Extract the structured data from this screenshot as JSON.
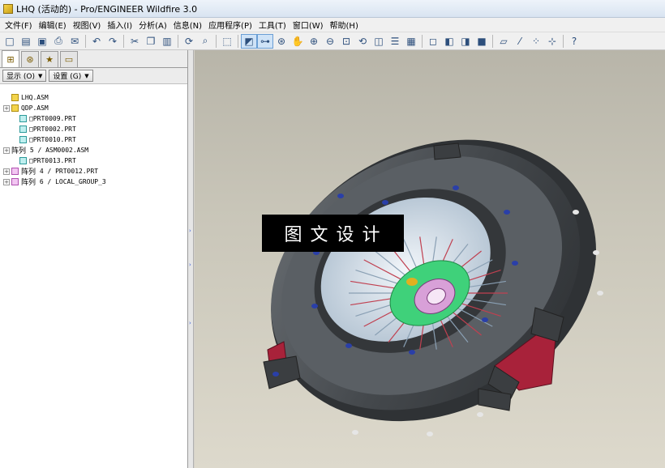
{
  "window": {
    "title": "LHQ (活动的) - Pro/ENGINEER Wildfire 3.0"
  },
  "menu": [
    "文件(F)",
    "编辑(E)",
    "视图(V)",
    "插入(I)",
    "分析(A)",
    "信息(N)",
    "应用程序(P)",
    "工具(T)",
    "窗口(W)",
    "帮助(H)"
  ],
  "toolbar": {
    "icons": [
      "new-icon",
      "open-icon",
      "save-icon",
      "print-icon",
      "email-icon",
      "undo-icon",
      "redo-icon",
      "cut-icon",
      "copy-icon",
      "paste-icon",
      "regenerate-icon",
      "find-icon",
      "select-box-icon",
      "sketch-plane-icon",
      "datum-display-icon",
      "spin-center-icon",
      "pan-icon",
      "zoom-in-icon",
      "zoom-out-icon",
      "refit-icon",
      "reorient-icon",
      "saved-views-icon",
      "layers-icon",
      "view-manager-icon",
      "wireframe-icon",
      "hidden-line-icon",
      "no-hidden-icon",
      "shading-icon",
      "datum-planes-icon",
      "datum-axes-icon",
      "datum-points-icon",
      "coordinate-systems-icon",
      "context-help-icon"
    ]
  },
  "panel": {
    "tabs": [
      "model-tree-icon",
      "layers-tab-icon",
      "favorites-tab-icon",
      "folder-browser-icon"
    ],
    "show_dropdown": "显示 (O)",
    "settings_dropdown": "设置 (G)",
    "tree": [
      {
        "level": 0,
        "expand": "",
        "icon": "asm",
        "cn": "",
        "label": "LHQ.ASM"
      },
      {
        "level": 0,
        "expand": "+",
        "icon": "asm",
        "cn": "",
        "label": "QDP.ASM"
      },
      {
        "level": 1,
        "expand": "",
        "icon": "prt",
        "cn": "",
        "label": "□PRT0009.PRT"
      },
      {
        "level": 1,
        "expand": "",
        "icon": "prt",
        "cn": "",
        "label": "□PRT0002.PRT"
      },
      {
        "level": 1,
        "expand": "",
        "icon": "prt",
        "cn": "",
        "label": "□PRT0010.PRT"
      },
      {
        "level": 0,
        "expand": "+",
        "icon": "",
        "cn": "阵列",
        "label": "5 / ASM0002.ASM"
      },
      {
        "level": 1,
        "expand": "",
        "icon": "prt",
        "cn": "",
        "label": "□PRT0013.PRT"
      },
      {
        "level": 0,
        "expand": "+",
        "icon": "pat",
        "cn": "阵列",
        "label": "4 / PRT0012.PRT"
      },
      {
        "level": 0,
        "expand": "+",
        "icon": "pat",
        "cn": "阵列",
        "label": "6 / LOCAL_GROUP_3"
      }
    ]
  },
  "viewport": {
    "watermark": "图文设计",
    "colors": {
      "housing": "#4b4f53",
      "diaphragm": "#dce7ef",
      "hub": "#3fd17a",
      "spline": "#d8a0d8",
      "bracket": "#a8223a",
      "bolt": "#2a3fa8"
    }
  }
}
